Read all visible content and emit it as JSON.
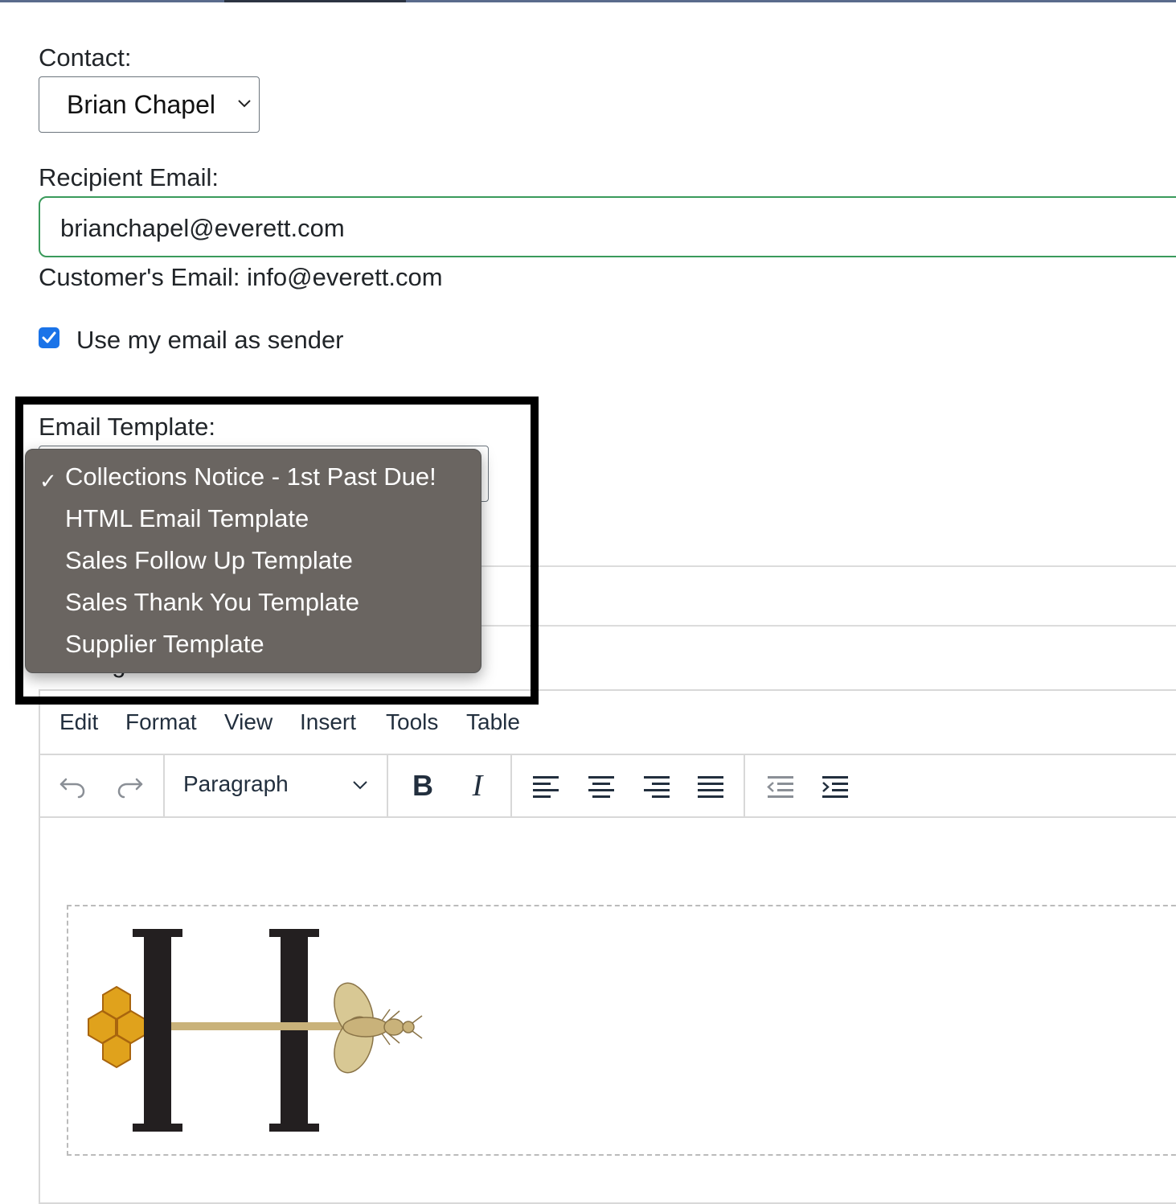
{
  "form": {
    "contact_label": "Contact:",
    "contact_value": "Brian Chapel",
    "recipient_label": "Recipient Email:",
    "recipient_value": "brianchapel@everett.com",
    "customer_email_text": "Customer's Email: info@everett.com",
    "use_my_email_label": "Use my email as sender",
    "use_my_email_checked": true,
    "template_label": "Email Template:",
    "message_label": "Message:"
  },
  "template_dropdown": {
    "selected": "Collections Notice - 1st Past Due!",
    "check_glyph": "✓",
    "options": [
      "Collections Notice - 1st Past Due!",
      "HTML Email Template",
      "Sales Follow Up Template",
      "Sales Thank You Template",
      "Supplier Template"
    ]
  },
  "editor": {
    "menu": [
      "Edit",
      "Format",
      "View",
      "Insert",
      "Tools",
      "Table"
    ],
    "block_format": "Paragraph",
    "toolbar_icons": [
      "undo-icon",
      "redo-icon",
      "bold-icon",
      "italic-icon",
      "align-left-icon",
      "align-center-icon",
      "align-right-icon",
      "align-justify-icon",
      "outdent-icon",
      "indent-icon"
    ],
    "bold_glyph": "B",
    "italic_glyph": "I",
    "logo": "H-honeycomb-bee-logo"
  },
  "colors": {
    "checkbox": "#1a73e8",
    "input_focus_border": "#3a9a5b",
    "dropdown_bg": "#6a6561",
    "logo_letter": "#231f20",
    "honeycomb": "#e0a21c",
    "bee": "#c9b27a"
  }
}
